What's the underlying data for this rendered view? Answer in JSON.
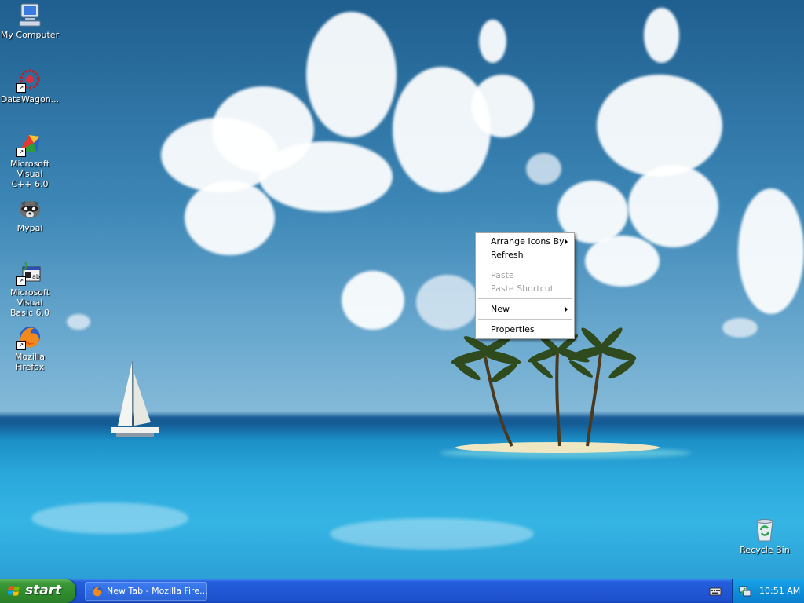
{
  "desktop": {
    "icons": [
      {
        "label": "My Computer",
        "icon": "my-computer-icon"
      },
      {
        "label": "DataWagon...",
        "icon": "datawagon-icon"
      },
      {
        "label": "Microsoft Visual\nC++ 6.0",
        "icon": "visual-cpp-icon"
      },
      {
        "label": "Mypal",
        "icon": "mypal-icon"
      },
      {
        "label": "Microsoft Visual\nBasic 6.0",
        "icon": "visual-basic-icon"
      },
      {
        "label": "Mozilla Firefox",
        "icon": "firefox-icon"
      },
      {
        "label": "Recycle Bin",
        "icon": "recycle-bin-icon"
      }
    ]
  },
  "context_menu": {
    "items": [
      {
        "label": "Arrange Icons By",
        "has_submenu": true,
        "enabled": true
      },
      {
        "label": "Refresh",
        "enabled": true
      },
      {
        "label": "Paste",
        "enabled": false
      },
      {
        "label": "Paste Shortcut",
        "enabled": false
      },
      {
        "label": "New",
        "has_submenu": true,
        "enabled": true
      },
      {
        "label": "Properties",
        "enabled": true
      }
    ]
  },
  "taskbar": {
    "start_label": "start",
    "tasks": [
      {
        "label": "New Tab - Mozilla Fire...",
        "icon": "firefox-icon"
      }
    ],
    "tray": {
      "icons": [
        "keyboard-icon",
        "network-icon"
      ],
      "clock": "10:51 AM"
    }
  },
  "colors": {
    "taskbar": "#245edb",
    "start_button": "#3c9a3a",
    "tray": "#0f8fd9",
    "disabled_text": "#a0a0a0"
  }
}
